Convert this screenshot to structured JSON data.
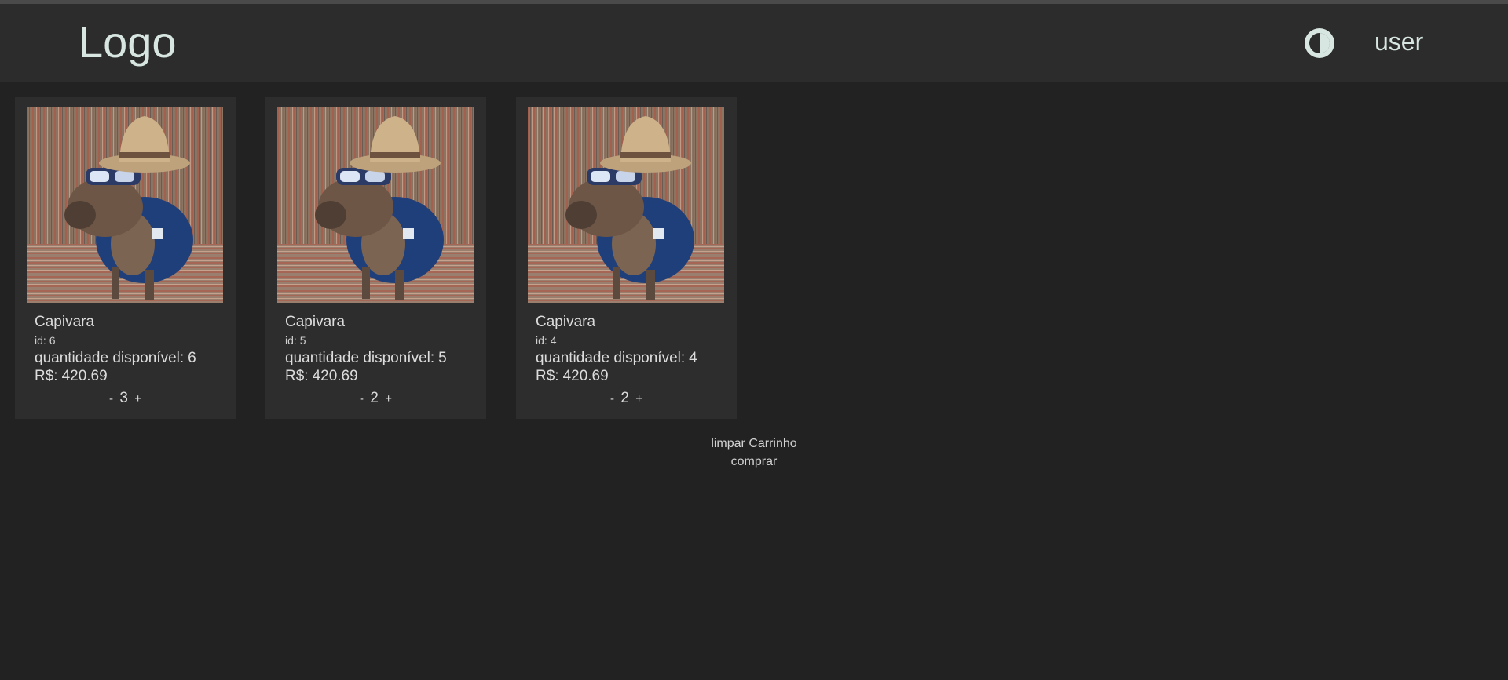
{
  "header": {
    "logo": "Logo",
    "theme_toggle_icon": "contrast-icon",
    "user_label": "user"
  },
  "products": [
    {
      "name": "Capivara",
      "id_label": "id:",
      "id": "6",
      "stock_label": "quantidade disponível:",
      "stock": "6",
      "price_label": "R$:",
      "price": "420.69",
      "decrement": "-",
      "quantity": "3",
      "increment": "+"
    },
    {
      "name": "Capivara",
      "id_label": "id:",
      "id": "5",
      "stock_label": "quantidade disponível:",
      "stock": "5",
      "price_label": "R$:",
      "price": "420.69",
      "decrement": "-",
      "quantity": "2",
      "increment": "+"
    },
    {
      "name": "Capivara",
      "id_label": "id:",
      "id": "4",
      "stock_label": "quantidade disponível:",
      "stock": "4",
      "price_label": "R$:",
      "price": "420.69",
      "decrement": "-",
      "quantity": "2",
      "increment": "+"
    }
  ],
  "cart_actions": {
    "clear_label": "limpar Carrinho",
    "buy_label": "comprar"
  },
  "colors": {
    "background": "#222222",
    "header": "#2c2c2c",
    "card": "#2d2d2d",
    "logo_text": "#d8e6e2"
  }
}
